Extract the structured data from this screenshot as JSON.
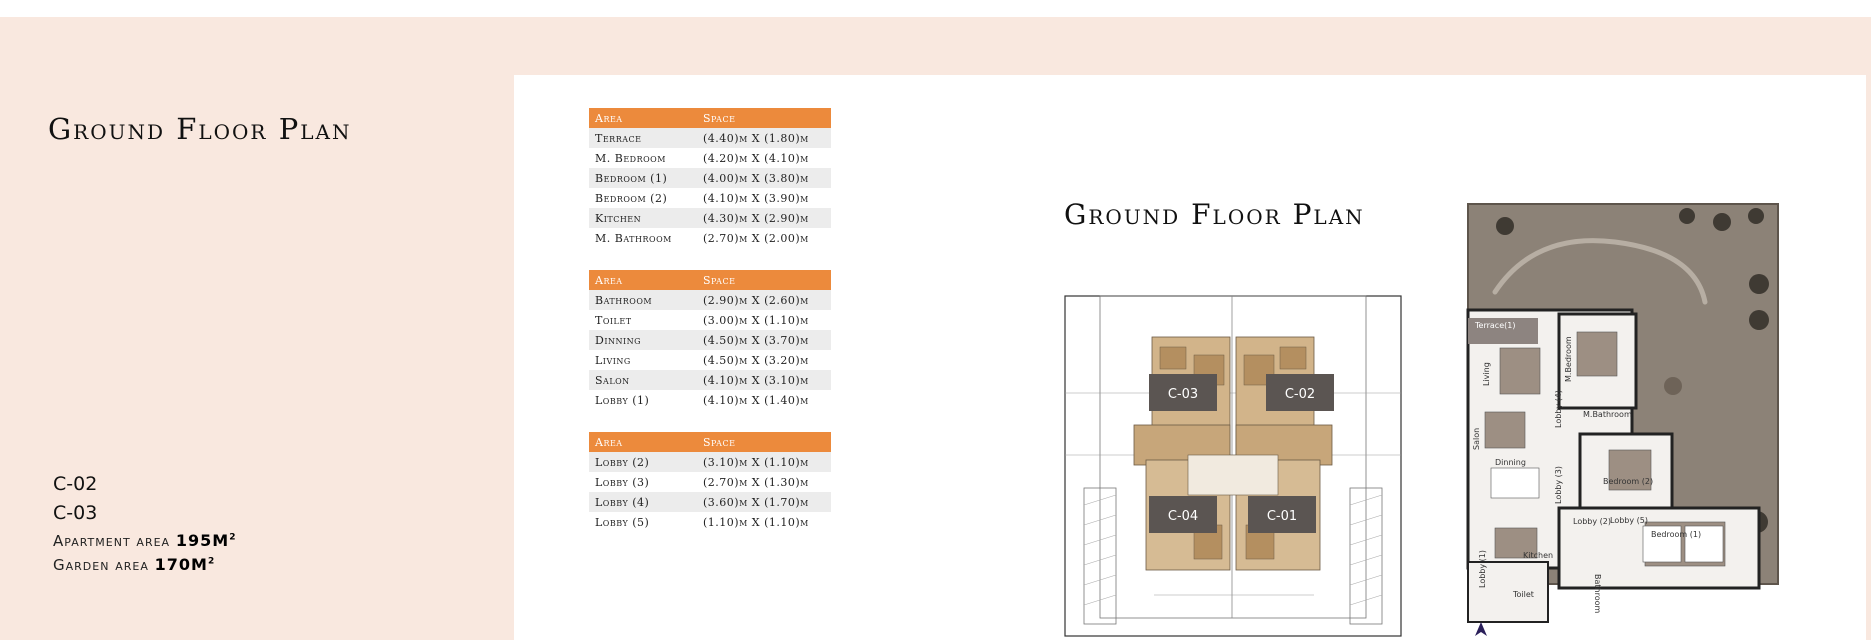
{
  "page_title": "Ground Floor Plan",
  "units": [
    "C-02",
    "C-03"
  ],
  "apartment_area": {
    "label": "Apartment area",
    "value": "195M",
    "sup": "2"
  },
  "garden_area": {
    "label": "Garden area",
    "value": "170M",
    "sup": "2"
  },
  "tables": [
    {
      "headers": [
        "Area",
        "Space"
      ],
      "rows": [
        [
          "Terrace",
          "(4.40)m X (1.80)m"
        ],
        [
          "M. Bedroom",
          "(4.20)m X (4.10)m"
        ],
        [
          "Bedroom (1)",
          "(4.00)m X (3.80)m"
        ],
        [
          "Bedroom (2)",
          "(4.10)m X (3.90)m"
        ],
        [
          "Kitchen",
          "(4.30)m X (2.90)m"
        ],
        [
          "M. Bathroom",
          "(2.70)m X (2.00)m"
        ]
      ]
    },
    {
      "headers": [
        "Area",
        "Space"
      ],
      "rows": [
        [
          "Bathroom",
          "(2.90)m X (2.60)m"
        ],
        [
          "Toilet",
          "(3.00)m X (1.10)m"
        ],
        [
          "Dinning",
          "(4.50)m X (3.70)m"
        ],
        [
          "Living",
          "(4.50)m X (3.20)m"
        ],
        [
          "Salon",
          "(4.10)m X (3.10)m"
        ],
        [
          "Lobby (1)",
          "(4.10)m X (1.40)m"
        ]
      ]
    },
    {
      "headers": [
        "Area",
        "Space"
      ],
      "rows": [
        [
          "Lobby (2)",
          "(3.10)m X (1.10)m"
        ],
        [
          "Lobby (3)",
          "(2.70)m X (1.30)m"
        ],
        [
          "Lobby (4)",
          "(3.60)m X (1.70)m"
        ],
        [
          "Lobby (5)",
          "(1.10)m X (1.10)m"
        ]
      ]
    }
  ],
  "building_units": [
    "C-03",
    "C-02",
    "C-04",
    "C-01"
  ],
  "room_labels": {
    "terrace": "Terrace(1)",
    "living": "Living",
    "m_bedroom": "M.Bedroom",
    "m_bathroom": "M.Bathroom",
    "salon": "Salon",
    "dinning": "Dinning",
    "lobby1": "Lobby (1)",
    "lobby2": "Lobby (2)",
    "lobby3": "Lobby (3)",
    "lobby4": "Lobby (4)",
    "lobby5": "Lobby (5)",
    "bedroom2": "Bedroom (2)",
    "bedroom1": "Bedroom (1)",
    "kitchen": "Kitchen",
    "bathroom": "Bathroom",
    "toilet": "Toilet"
  },
  "colors": {
    "accent": "#ec8a3c",
    "panel": "#f9e8df",
    "unit_tag": "#5b5552",
    "garden": "#8c8277"
  },
  "icons": {
    "north": "north-arrow-icon"
  }
}
